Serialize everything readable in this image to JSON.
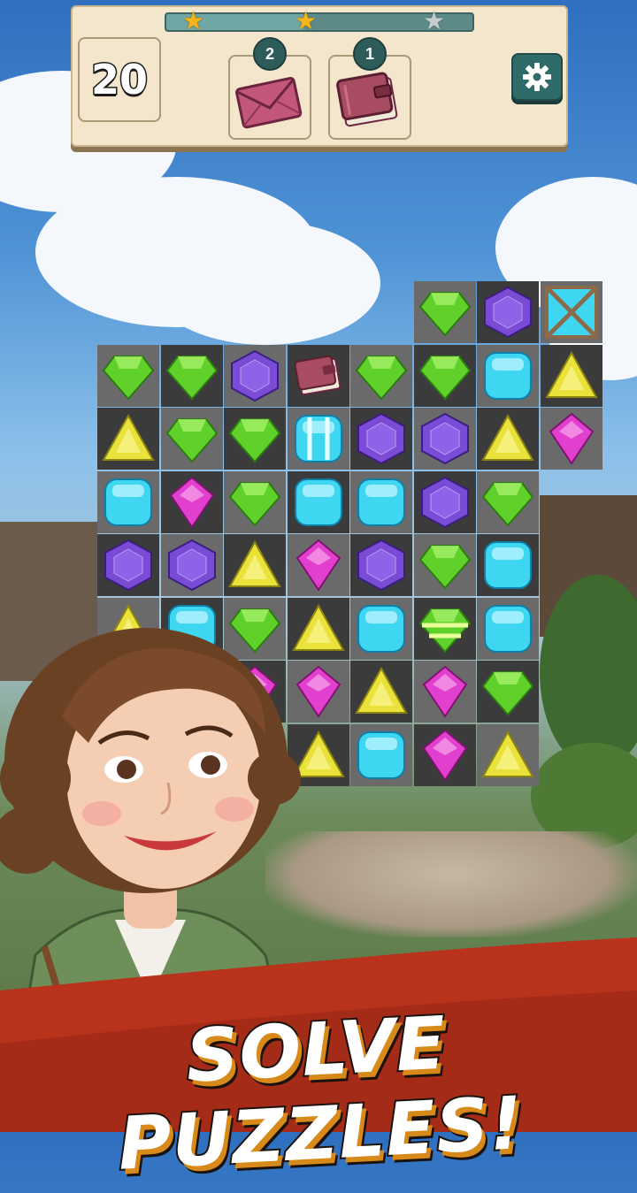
{
  "hud": {
    "moves_left": "20",
    "progress_fraction": 0.45,
    "stars": [
      {
        "icon": "star-icon",
        "earned": true
      },
      {
        "icon": "star-icon",
        "earned": true
      },
      {
        "icon": "star-icon",
        "earned": false
      }
    ],
    "goals": [
      {
        "icon": "envelope-icon",
        "count": "2"
      },
      {
        "icon": "book-icon",
        "count": "1"
      }
    ],
    "settings_icon": "gear-icon"
  },
  "board": {
    "rows": [
      [
        "x",
        "x",
        "x",
        "x",
        "x",
        "green",
        "purple",
        "ice"
      ],
      [
        "green",
        "green",
        "purple",
        "book",
        "green",
        "green",
        "blue",
        "yellow"
      ],
      [
        "yellow",
        "green",
        "green",
        "blue-striped",
        "purple",
        "purple",
        "yellow",
        "pink"
      ],
      [
        "blue",
        "pink",
        "green",
        "blue",
        "blue",
        "purple",
        "green",
        "x"
      ],
      [
        "purple",
        "purple",
        "yellow",
        "pink",
        "purple",
        "green",
        "blue",
        "x"
      ],
      [
        "yellow",
        "blue",
        "green",
        "yellow",
        "blue",
        "green-striped",
        "blue",
        "x"
      ],
      [
        "x",
        "x",
        "pink",
        "pink",
        "yellow",
        "pink",
        "green",
        "x"
      ],
      [
        "x",
        "x",
        "x",
        "yellow",
        "blue",
        "pink",
        "yellow",
        "x"
      ]
    ],
    "colors": {
      "green": "#5fd12a",
      "purple": "#7a4cd6",
      "blue": "#3fd6f2",
      "yellow": "#e9e23a",
      "pink": "#e23fcf",
      "dark_cell": "#3b3b3b",
      "light_cell": "#6a6a6a"
    }
  },
  "banner": {
    "text": "SOLVE PUZZLES!",
    "color": "#b8321c"
  }
}
